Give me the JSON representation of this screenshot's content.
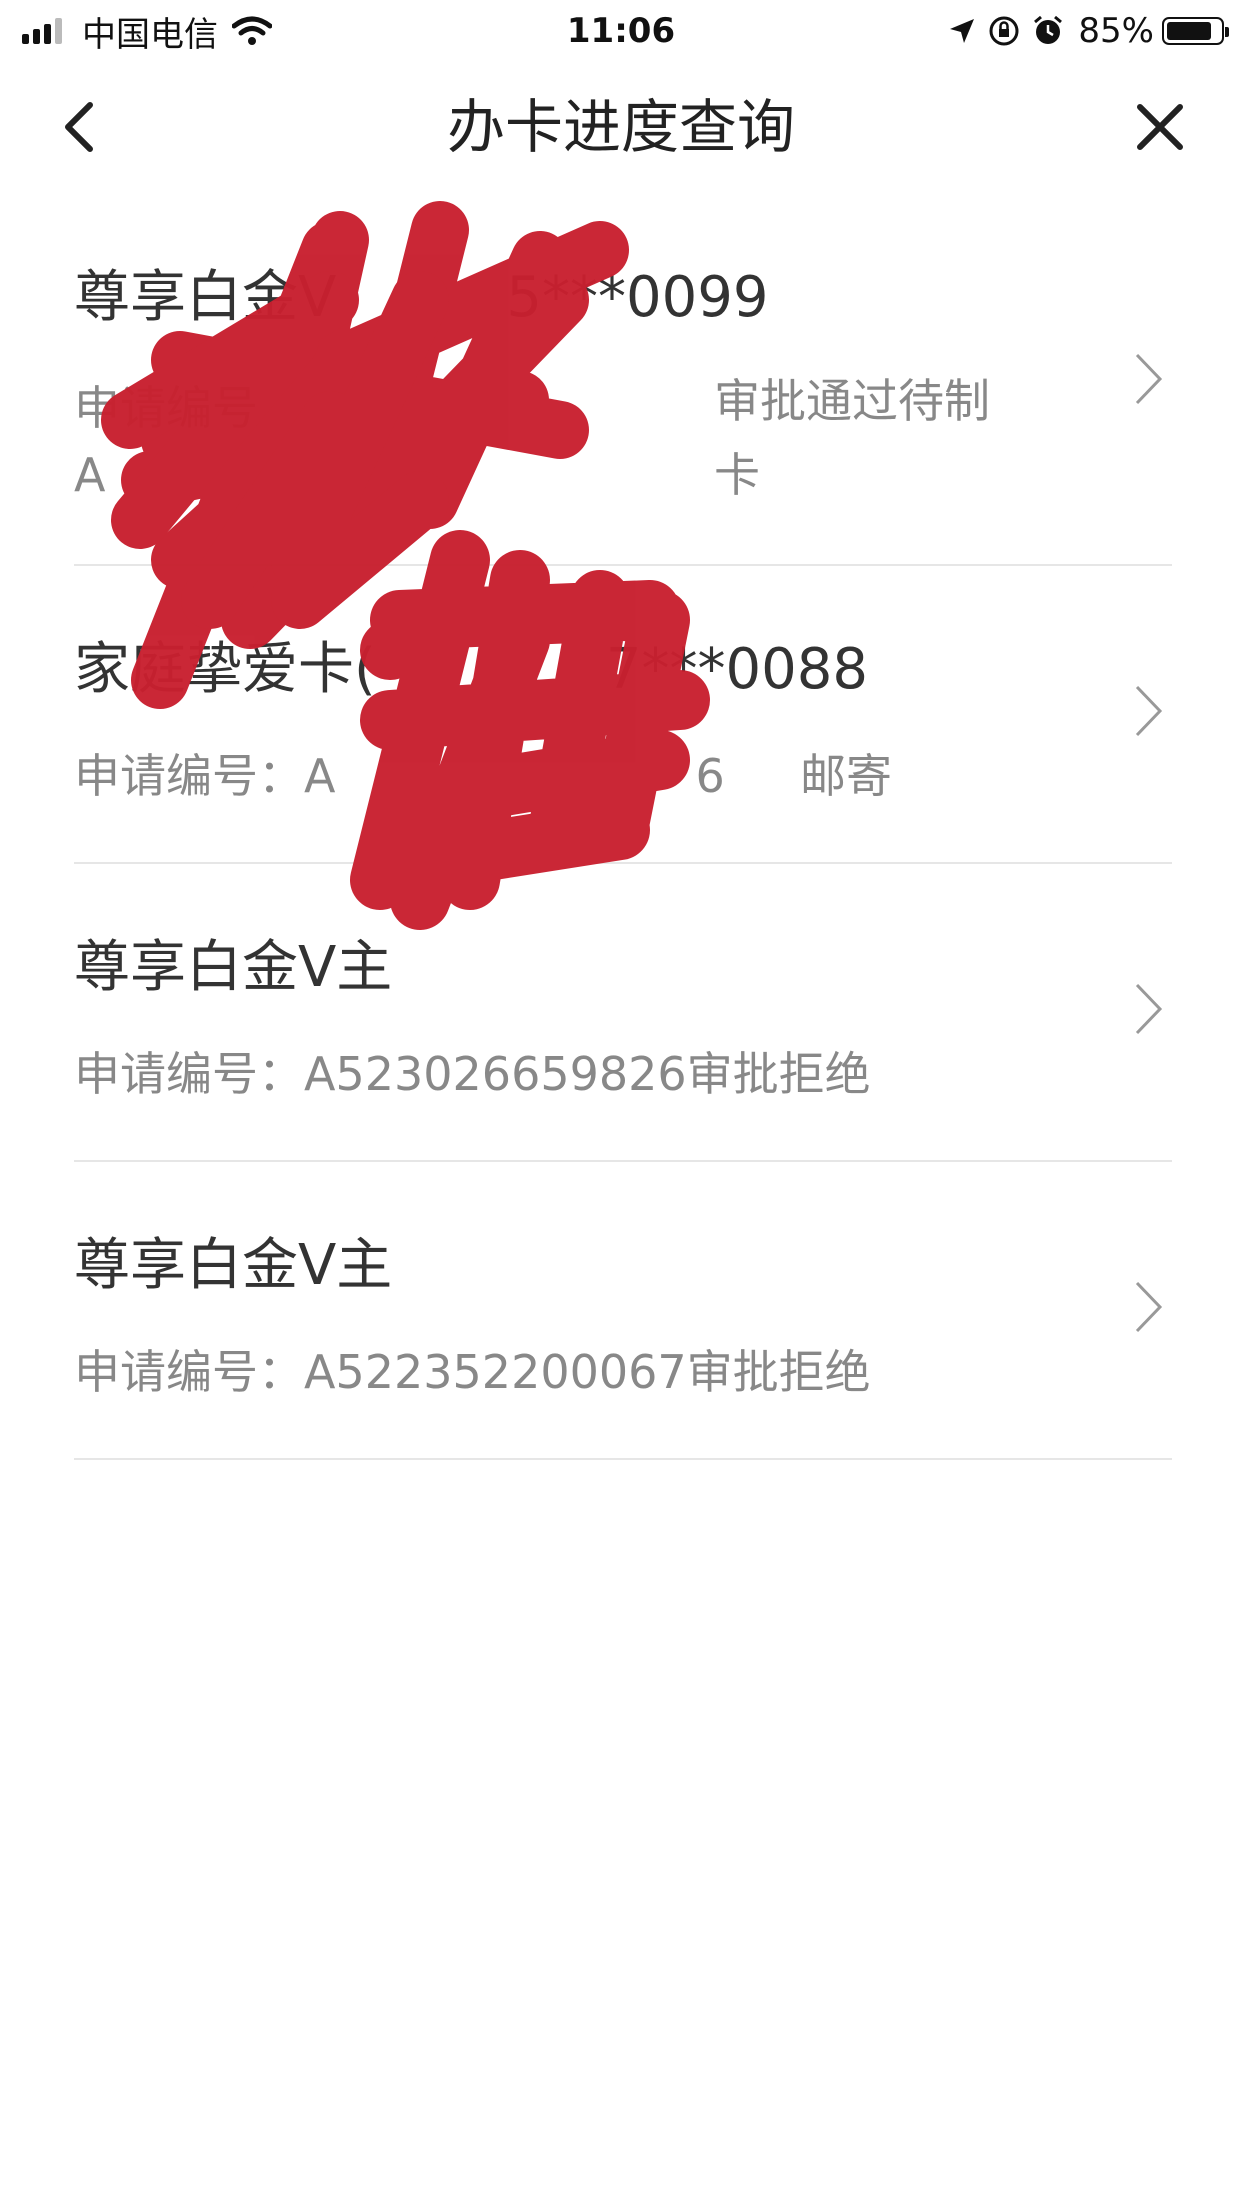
{
  "status_bar": {
    "carrier": "中国电信",
    "time": "11:06",
    "battery": "85%",
    "battery_level": 0.85,
    "icons": [
      "signal-icon",
      "wifi-icon",
      "location-icon",
      "rotation-lock-icon",
      "alarm-icon",
      "battery-icon"
    ]
  },
  "nav": {
    "title": "办卡进度查询",
    "back_icon": "chevron-left-icon",
    "close_icon": "close-icon"
  },
  "items": [
    {
      "title_prefix": "尊享白金V",
      "title_suffix": "5***0099",
      "sub_prefix_line1": "申请编号",
      "sub_prefix_line2": "A",
      "status": "审批通过待制卡"
    },
    {
      "title_prefix": "家庭挚爱卡(",
      "title_suffix": "7***0088",
      "sub_prefix": "申请编号：A",
      "sub_suffix": "6",
      "delivery": "邮寄"
    },
    {
      "title": "尊享白金V主",
      "sub": "申请编号：A523026659826审批拒绝"
    },
    {
      "title": "尊享白金V主",
      "sub": "申请编号：A522352200067审批拒绝"
    }
  ],
  "colors": {
    "scribble": "#c8202f",
    "divider": "#e6e6e6",
    "secondary_text": "#888888"
  }
}
